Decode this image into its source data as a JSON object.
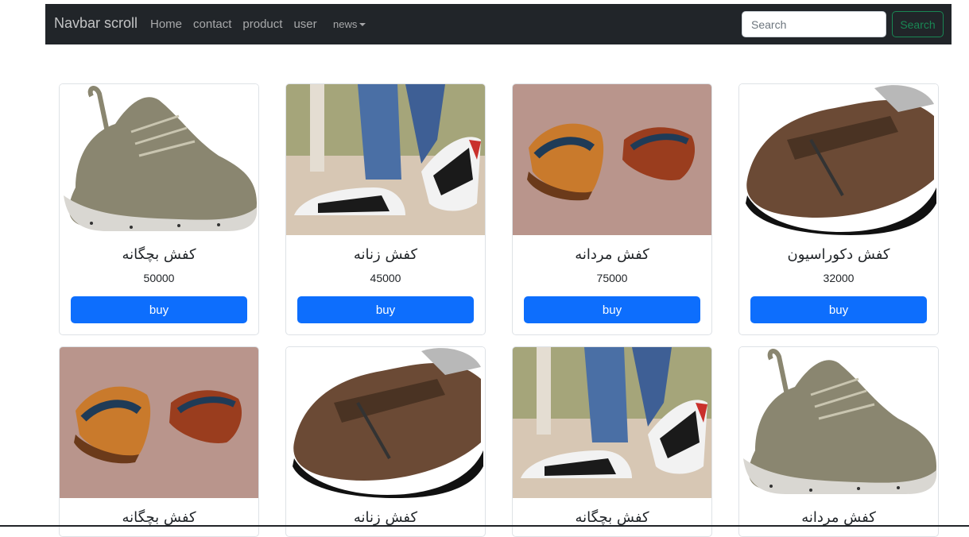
{
  "navbar": {
    "brand": "Navbar scroll",
    "links": [
      "Home",
      "contact",
      "product",
      "user"
    ],
    "dropdown_label": "news",
    "search_placeholder": "Search",
    "search_button": "Search"
  },
  "colors": {
    "navbar_bg": "#212529",
    "primary": "#0d6efd",
    "success": "#198754"
  },
  "products": [
    {
      "title": "کفش بچگانه",
      "price": "50000",
      "button": "buy",
      "image": "green-knit-sneaker"
    },
    {
      "title": "کفش زنانه",
      "price": "45000",
      "button": "buy",
      "image": "sneakers-on-feet"
    },
    {
      "title": "کفش مردانه",
      "price": "75000",
      "button": "buy",
      "image": "brogue-pair"
    },
    {
      "title": "کفش دکوراسیون",
      "price": "32000",
      "button": "buy",
      "image": "brown-strap-shoes"
    },
    {
      "title": "کفش بچگانه",
      "image": "brogue-pair"
    },
    {
      "title": "کفش زنانه",
      "image": "brown-strap-shoes"
    },
    {
      "title": "کفش بچگانه",
      "image": "sneakers-on-feet"
    },
    {
      "title": "کفش مردانه",
      "image": "green-knit-sneaker"
    }
  ]
}
